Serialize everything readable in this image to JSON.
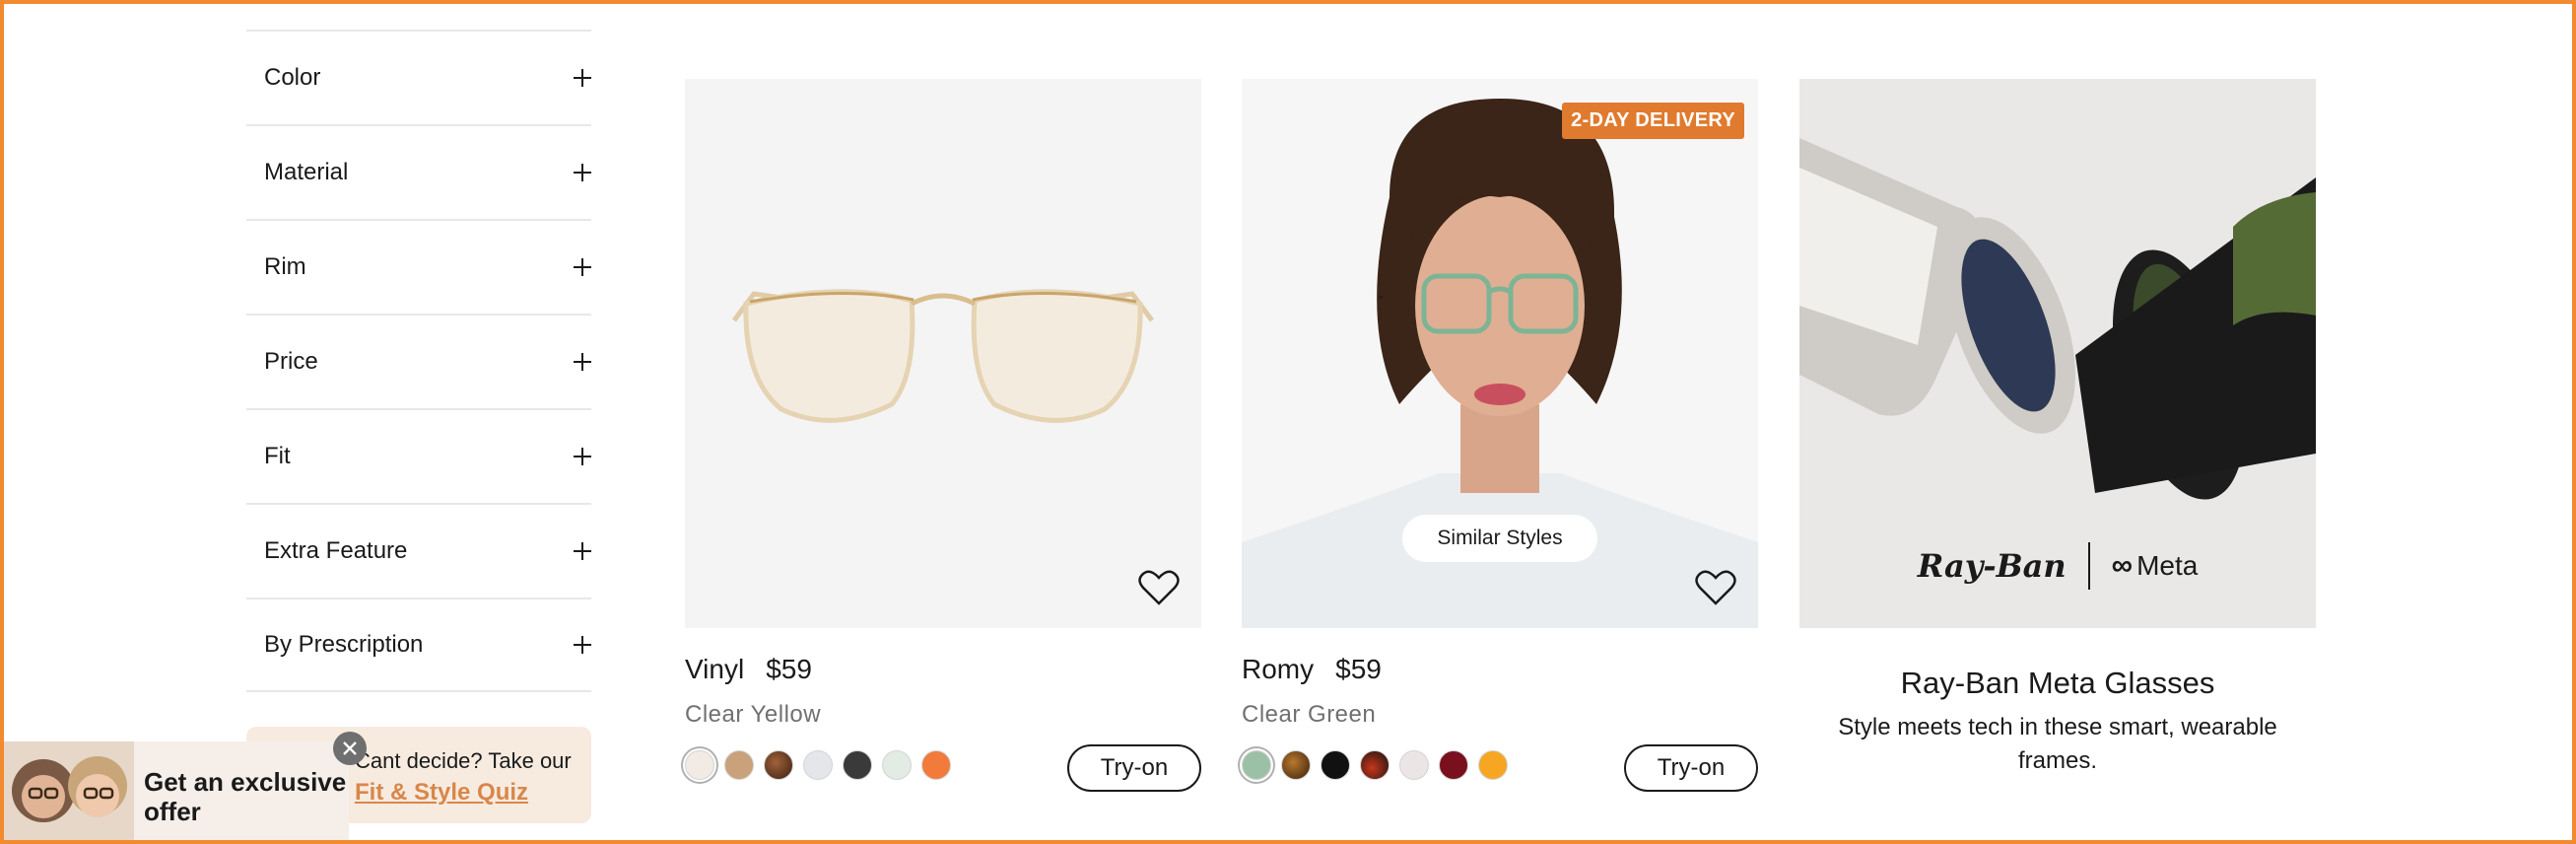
{
  "filters": [
    {
      "label": "Color"
    },
    {
      "label": "Material"
    },
    {
      "label": "Rim"
    },
    {
      "label": "Price"
    },
    {
      "label": "Fit"
    },
    {
      "label": "Extra Feature"
    },
    {
      "label": "By Prescription"
    }
  ],
  "quiz": {
    "text": "Cant decide? Take our",
    "link": "Fit & Style Quiz"
  },
  "offer": {
    "line1": "Get an exclusive",
    "line2": "offer"
  },
  "products": [
    {
      "name": "Vinyl",
      "price": "$59",
      "color_name": "Clear Yellow",
      "try_on": "Try-on",
      "swatches": [
        "#f1ebe3",
        "#c9a17a",
        "#6b3b22",
        "#e4e6ea",
        "#3a3a3a",
        "#e3ebe5",
        "#f27a3a"
      ]
    },
    {
      "name": "Romy",
      "price": "$59",
      "color_name": "Clear Green",
      "try_on": "Try-on",
      "badge": "2-DAY DELIVERY",
      "similar": "Similar Styles",
      "swatches": [
        "#9cc0a6",
        "#7a4a1e",
        "#111111",
        "#5a1a0a",
        "#ece5e6",
        "#7a0f1e",
        "#f6a623"
      ]
    }
  ],
  "promo": {
    "title": "Ray-Ban Meta Glasses",
    "subtitle": "Style meets tech in these smart, wearable frames.",
    "brand_left": "Ray-Ban",
    "brand_right": "Meta"
  },
  "colors": {
    "accent": "#e07a2e",
    "quiz_link": "#d8874a",
    "frame": "#f28a30"
  }
}
